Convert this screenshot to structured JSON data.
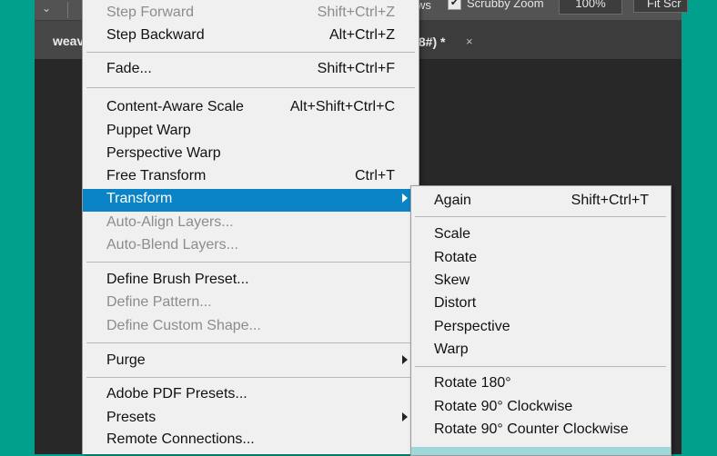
{
  "options_bar": {
    "workspace_fragment": "ws",
    "scrubby_zoom_label": "Scrubby Zoom",
    "scrubby_zoom_checked": true,
    "zoom_value": "100%",
    "fit_screen_label": "Fit Scr"
  },
  "tabs": {
    "left_tab_label": "weav",
    "right_tab_label": "/8#) *",
    "close_glyph": "×"
  },
  "edit_menu": {
    "items": [
      {
        "label": "Step Forward",
        "shortcut": "Shift+Ctrl+Z",
        "disabled": true
      },
      {
        "label": "Step Backward",
        "shortcut": "Alt+Ctrl+Z",
        "disabled": false
      },
      {
        "label": "Fade...",
        "shortcut": "Shift+Ctrl+F",
        "disabled": false
      },
      {
        "label": "Content-Aware Scale",
        "shortcut": "Alt+Shift+Ctrl+C",
        "disabled": false
      },
      {
        "label": "Puppet Warp",
        "shortcut": "",
        "disabled": false
      },
      {
        "label": "Perspective Warp",
        "shortcut": "",
        "disabled": false
      },
      {
        "label": "Free Transform",
        "shortcut": "Ctrl+T",
        "disabled": false
      },
      {
        "label": "Transform",
        "shortcut": "",
        "disabled": false,
        "selected": true,
        "submenu": true
      },
      {
        "label": "Auto-Align Layers...",
        "shortcut": "",
        "disabled": true
      },
      {
        "label": "Auto-Blend Layers...",
        "shortcut": "",
        "disabled": true
      },
      {
        "label": "Define Brush Preset...",
        "shortcut": "",
        "disabled": false
      },
      {
        "label": "Define Pattern...",
        "shortcut": "",
        "disabled": true
      },
      {
        "label": "Define Custom Shape...",
        "shortcut": "",
        "disabled": true
      },
      {
        "label": "Purge",
        "shortcut": "",
        "disabled": false,
        "submenu": true
      },
      {
        "label": "Adobe PDF Presets...",
        "shortcut": "",
        "disabled": false
      },
      {
        "label": "Presets",
        "shortcut": "",
        "disabled": false,
        "submenu": true
      },
      {
        "label": "Remote Connections...",
        "shortcut": "",
        "disabled": false
      }
    ]
  },
  "transform_submenu": {
    "items": [
      {
        "label": "Again",
        "shortcut": "Shift+Ctrl+T"
      },
      {
        "label": "Scale",
        "shortcut": ""
      },
      {
        "label": "Rotate",
        "shortcut": ""
      },
      {
        "label": "Skew",
        "shortcut": ""
      },
      {
        "label": "Distort",
        "shortcut": ""
      },
      {
        "label": "Perspective",
        "shortcut": ""
      },
      {
        "label": "Warp",
        "shortcut": ""
      },
      {
        "label": "Rotate 180°",
        "shortcut": ""
      },
      {
        "label": "Rotate 90° Clockwise",
        "shortcut": ""
      },
      {
        "label": "Rotate 90° Counter Clockwise",
        "shortcut": ""
      }
    ]
  },
  "colors": {
    "background_teal": "#00a08c",
    "menu_bg": "#f0f0f0",
    "highlight_blue": "#0a84c6",
    "disabled_text": "#8c8c8c"
  }
}
